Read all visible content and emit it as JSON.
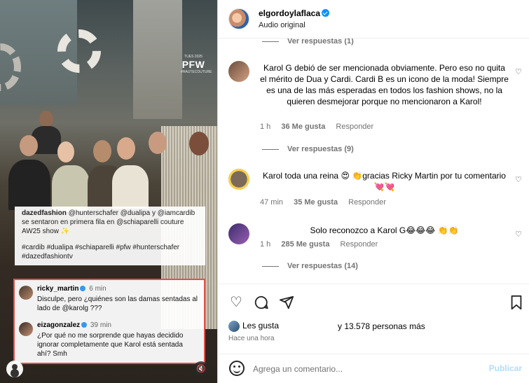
{
  "video": {
    "badge_top": "TUES 2025",
    "badge_main": "PFW",
    "badge_bottom": "#HAUTECOUTURE",
    "caption": {
      "user": "dazedfashion",
      "text": "@hunterschafer @dualipa y @iamcardib se sentaron en primera fila en @schiaparelli couture AW25 show ✨",
      "tags": "#cardib #dualipa #schiaparelli #pfw #hunterschafer #dazedfashiontv"
    },
    "overlay_comments": [
      {
        "user": "ricky_martin",
        "time": "6 min",
        "text": "Disculpe, pero ¿quiénes son las damas sentadas al lado de @karolg ???"
      },
      {
        "user": "eizagonzalez",
        "time": "39 min",
        "text": "¿Por qué no me sorprende que hayas decidido ignorar completamente que Karol está sentada ahí? Smh"
      }
    ],
    "mute_icon": "muted-speaker-icon",
    "user_icon": "user-icon"
  },
  "header": {
    "username": "elgordoylaflaca",
    "subtitle": "Audio original"
  },
  "comments": {
    "top_replies": "Ver respuestas (1)",
    "items": [
      {
        "text": "Karol G debió de ser mencionada obviamente. Pero eso no quita el mérito de Dua y Cardi. Cardi B es un icono de la moda! Siempre es una de las más esperadas en todos los fashion shows, no la quieren desmejorar porque no mencionaron a Karol!",
        "time": "1 h",
        "likes": "36 Me gusta",
        "reply": "Responder",
        "replies": "Ver respuestas (9)"
      },
      {
        "text": "Karol toda una reina 😍 👏gracias Ricky Martin por tu comentario 💘💘",
        "time": "47 min",
        "likes": "35 Me gusta",
        "reply": "Responder",
        "replies": ""
      },
      {
        "text": "Solo reconozco a Karol G😂😂😂 👏👏",
        "time": "1 h",
        "likes": "285 Me gusta",
        "reply": "Responder",
        "replies": "Ver respuestas (14)"
      }
    ]
  },
  "actions": {
    "like_icon": "heart-icon",
    "comment_icon": "comment-icon",
    "share_icon": "share-icon",
    "save_icon": "bookmark-icon",
    "likes_prefix": "Les gusta",
    "likes_more": "y 13.578 personas más",
    "posted": "Hace una hora"
  },
  "compose": {
    "placeholder": "Agrega un comentario...",
    "post_label": "Publicar"
  },
  "colors": {
    "verified": "#0095f6",
    "highlight_border": "#e0524b",
    "post_disabled": "#b3dbff"
  }
}
